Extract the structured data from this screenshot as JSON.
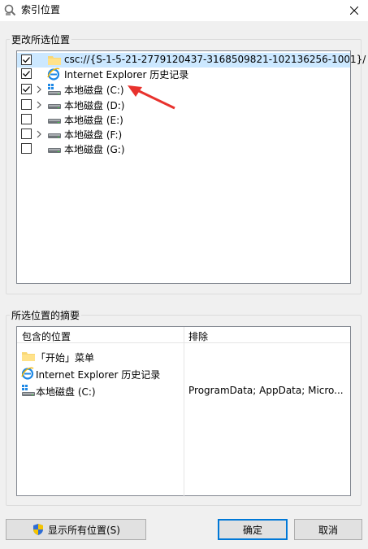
{
  "window": {
    "title": "索引位置",
    "close_glyph": "✕"
  },
  "change_group": {
    "label": "更改所选位置",
    "items": [
      {
        "label": "csc://{S-1-5-21-2779120437-3168509821-102136256-1001}/",
        "checked": true,
        "expandable": false,
        "icon": "folder-icon",
        "selected": true
      },
      {
        "label": "Internet Explorer 历史记录",
        "checked": true,
        "expandable": false,
        "icon": "ie-icon",
        "selected": false
      },
      {
        "label": "本地磁盘 (C:)",
        "checked": true,
        "expandable": true,
        "icon": "windows-drive-icon",
        "selected": false
      },
      {
        "label": "本地磁盘 (D:)",
        "checked": false,
        "expandable": true,
        "icon": "drive-icon",
        "selected": false
      },
      {
        "label": "本地磁盘 (E:)",
        "checked": false,
        "expandable": false,
        "icon": "drive-icon",
        "selected": false
      },
      {
        "label": "本地磁盘 (F:)",
        "checked": false,
        "expandable": true,
        "icon": "drive-icon",
        "selected": false
      },
      {
        "label": "本地磁盘 (G:)",
        "checked": false,
        "expandable": false,
        "icon": "drive-icon",
        "selected": false
      }
    ]
  },
  "summary_group": {
    "label": "所选位置的摘要",
    "col_included": "包含的位置",
    "col_excluded": "排除",
    "rows": [
      {
        "included": "「开始」菜单",
        "excluded": "",
        "icon": "folder-icon"
      },
      {
        "included": "Internet Explorer 历史记录",
        "excluded": "",
        "icon": "ie-icon"
      },
      {
        "included": "本地磁盘 (C:)",
        "excluded": "ProgramData; AppData; Micro...",
        "icon": "windows-drive-icon"
      }
    ]
  },
  "buttons": {
    "show_all": "显示所有位置(S)",
    "ok": "确定",
    "cancel": "取消"
  },
  "colors": {
    "accent": "#0078d7",
    "selection": "#cce8ff",
    "annotation_arrow": "#e8322d"
  }
}
